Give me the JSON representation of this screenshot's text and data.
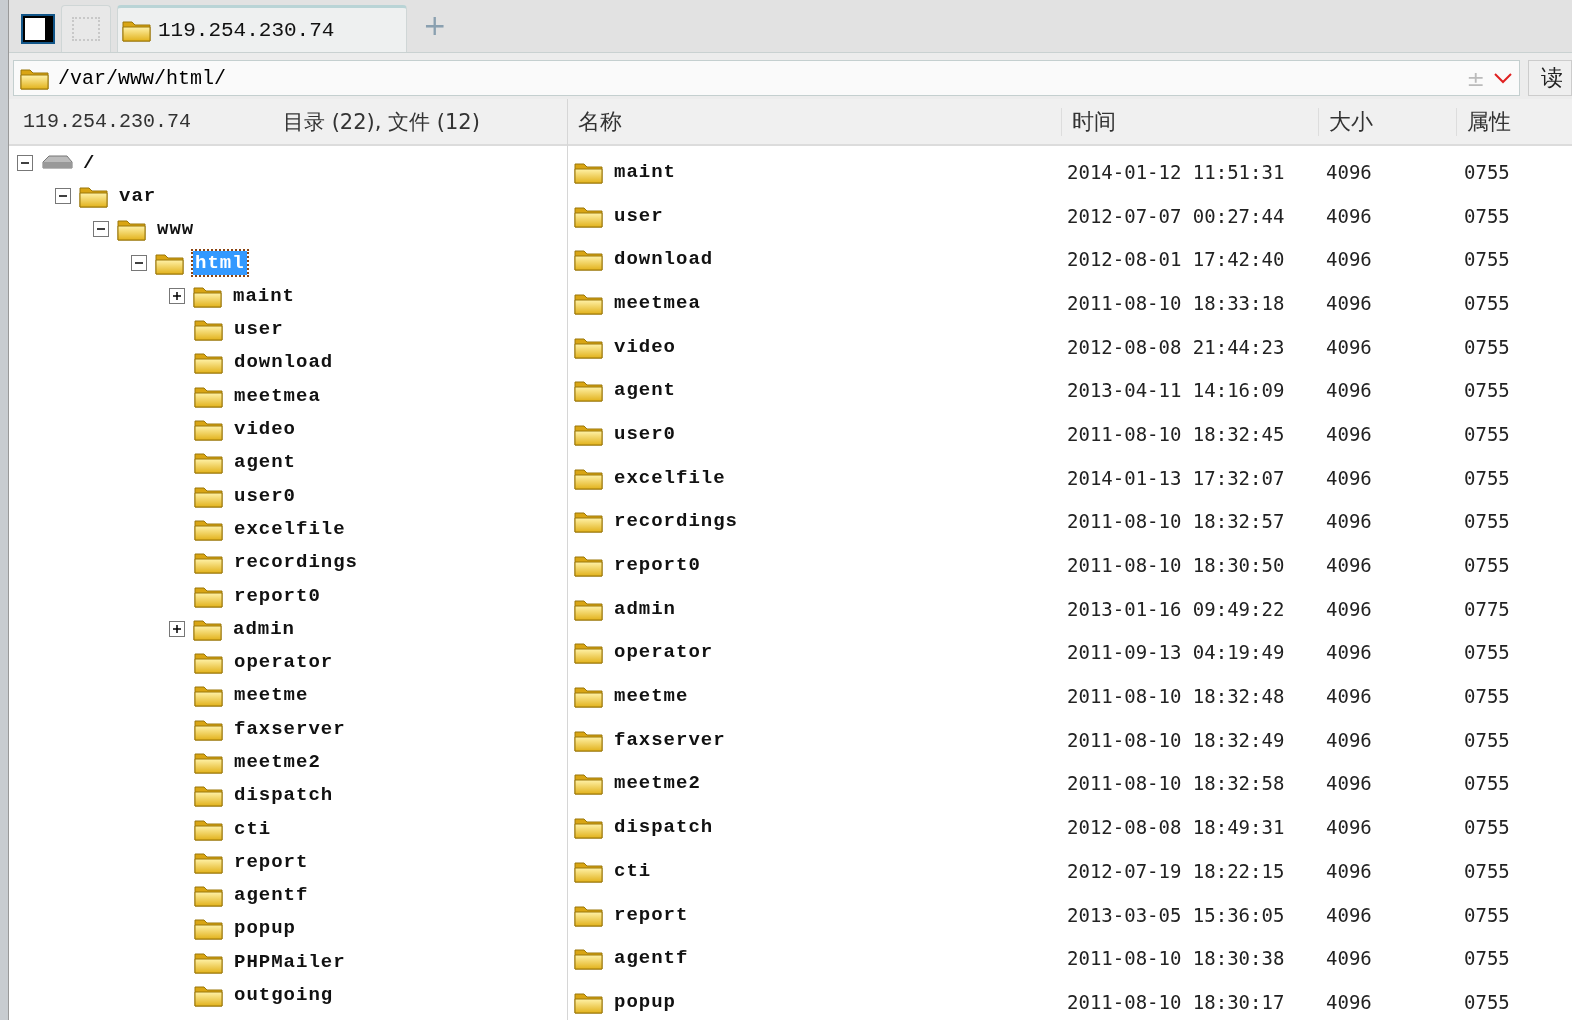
{
  "tabs": [
    {
      "kind": "blank",
      "selected": false
    },
    {
      "kind": "host",
      "label": "119.254.230.74",
      "selected": true
    }
  ],
  "new_tab": "+",
  "address": {
    "path": "/var/www/html/",
    "history": "±",
    "button": "读"
  },
  "status": {
    "host": "119.254.230.74",
    "summary": "目录 (22), 文件 (12)"
  },
  "columns": [
    "名称",
    "时间",
    "大小",
    "属性"
  ],
  "tree": {
    "name": "/",
    "kind": "open",
    "selected": false,
    "children": [
      {
        "name": "var",
        "kind": "open",
        "selected": false,
        "children": [
          {
            "name": "www",
            "kind": "open",
            "selected": false,
            "children": [
              {
                "name": "html",
                "kind": "open",
                "selected": true,
                "children": [
                  {
                    "name": "maint",
                    "kind": "closed",
                    "selected": false
                  },
                  {
                    "name": "user",
                    "kind": "leaf",
                    "selected": false
                  },
                  {
                    "name": "download",
                    "kind": "leaf",
                    "selected": false
                  },
                  {
                    "name": "meetmea",
                    "kind": "leaf",
                    "selected": false
                  },
                  {
                    "name": "video",
                    "kind": "leaf",
                    "selected": false
                  },
                  {
                    "name": "agent",
                    "kind": "leaf",
                    "selected": false
                  },
                  {
                    "name": "user0",
                    "kind": "leaf",
                    "selected": false
                  },
                  {
                    "name": "excelfile",
                    "kind": "leaf",
                    "selected": false
                  },
                  {
                    "name": "recordings",
                    "kind": "leaf",
                    "selected": false
                  },
                  {
                    "name": "report0",
                    "kind": "leaf",
                    "selected": false
                  },
                  {
                    "name": "admin",
                    "kind": "closed",
                    "selected": false
                  },
                  {
                    "name": "operator",
                    "kind": "leaf",
                    "selected": false
                  },
                  {
                    "name": "meetme",
                    "kind": "leaf",
                    "selected": false
                  },
                  {
                    "name": "faxserver",
                    "kind": "leaf",
                    "selected": false
                  },
                  {
                    "name": "meetme2",
                    "kind": "leaf",
                    "selected": false
                  },
                  {
                    "name": "dispatch",
                    "kind": "leaf",
                    "selected": false
                  },
                  {
                    "name": "cti",
                    "kind": "leaf",
                    "selected": false
                  },
                  {
                    "name": "report",
                    "kind": "leaf",
                    "selected": false
                  },
                  {
                    "name": "agentf",
                    "kind": "leaf",
                    "selected": false
                  },
                  {
                    "name": "popup",
                    "kind": "leaf",
                    "selected": false
                  },
                  {
                    "name": "PHPMailer",
                    "kind": "leaf",
                    "selected": false
                  },
                  {
                    "name": "outgoing",
                    "kind": "leaf",
                    "selected": false
                  }
                ]
              }
            ]
          }
        ]
      }
    ]
  },
  "rows": [
    {
      "name": "maint",
      "time": "2014-01-12 11:51:31",
      "size": "4096",
      "mode": "0755"
    },
    {
      "name": "user",
      "time": "2012-07-07 00:27:44",
      "size": "4096",
      "mode": "0755"
    },
    {
      "name": "download",
      "time": "2012-08-01 17:42:40",
      "size": "4096",
      "mode": "0755"
    },
    {
      "name": "meetmea",
      "time": "2011-08-10 18:33:18",
      "size": "4096",
      "mode": "0755"
    },
    {
      "name": "video",
      "time": "2012-08-08 21:44:23",
      "size": "4096",
      "mode": "0755"
    },
    {
      "name": "agent",
      "time": "2013-04-11 14:16:09",
      "size": "4096",
      "mode": "0755"
    },
    {
      "name": "user0",
      "time": "2011-08-10 18:32:45",
      "size": "4096",
      "mode": "0755"
    },
    {
      "name": "excelfile",
      "time": "2014-01-13 17:32:07",
      "size": "4096",
      "mode": "0755"
    },
    {
      "name": "recordings",
      "time": "2011-08-10 18:32:57",
      "size": "4096",
      "mode": "0755"
    },
    {
      "name": "report0",
      "time": "2011-08-10 18:30:50",
      "size": "4096",
      "mode": "0755"
    },
    {
      "name": "admin",
      "time": "2013-01-16 09:49:22",
      "size": "4096",
      "mode": "0775"
    },
    {
      "name": "operator",
      "time": "2011-09-13 04:19:49",
      "size": "4096",
      "mode": "0755"
    },
    {
      "name": "meetme",
      "time": "2011-08-10 18:32:48",
      "size": "4096",
      "mode": "0755"
    },
    {
      "name": "faxserver",
      "time": "2011-08-10 18:32:49",
      "size": "4096",
      "mode": "0755"
    },
    {
      "name": "meetme2",
      "time": "2011-08-10 18:32:58",
      "size": "4096",
      "mode": "0755"
    },
    {
      "name": "dispatch",
      "time": "2012-08-08 18:49:31",
      "size": "4096",
      "mode": "0755"
    },
    {
      "name": "cti",
      "time": "2012-07-19 18:22:15",
      "size": "4096",
      "mode": "0755"
    },
    {
      "name": "report",
      "time": "2013-03-05 15:36:05",
      "size": "4096",
      "mode": "0755"
    },
    {
      "name": "agentf",
      "time": "2011-08-10 18:30:38",
      "size": "4096",
      "mode": "0755"
    },
    {
      "name": "popup",
      "time": "2011-08-10 18:30:17",
      "size": "4096",
      "mode": "0755"
    }
  ]
}
